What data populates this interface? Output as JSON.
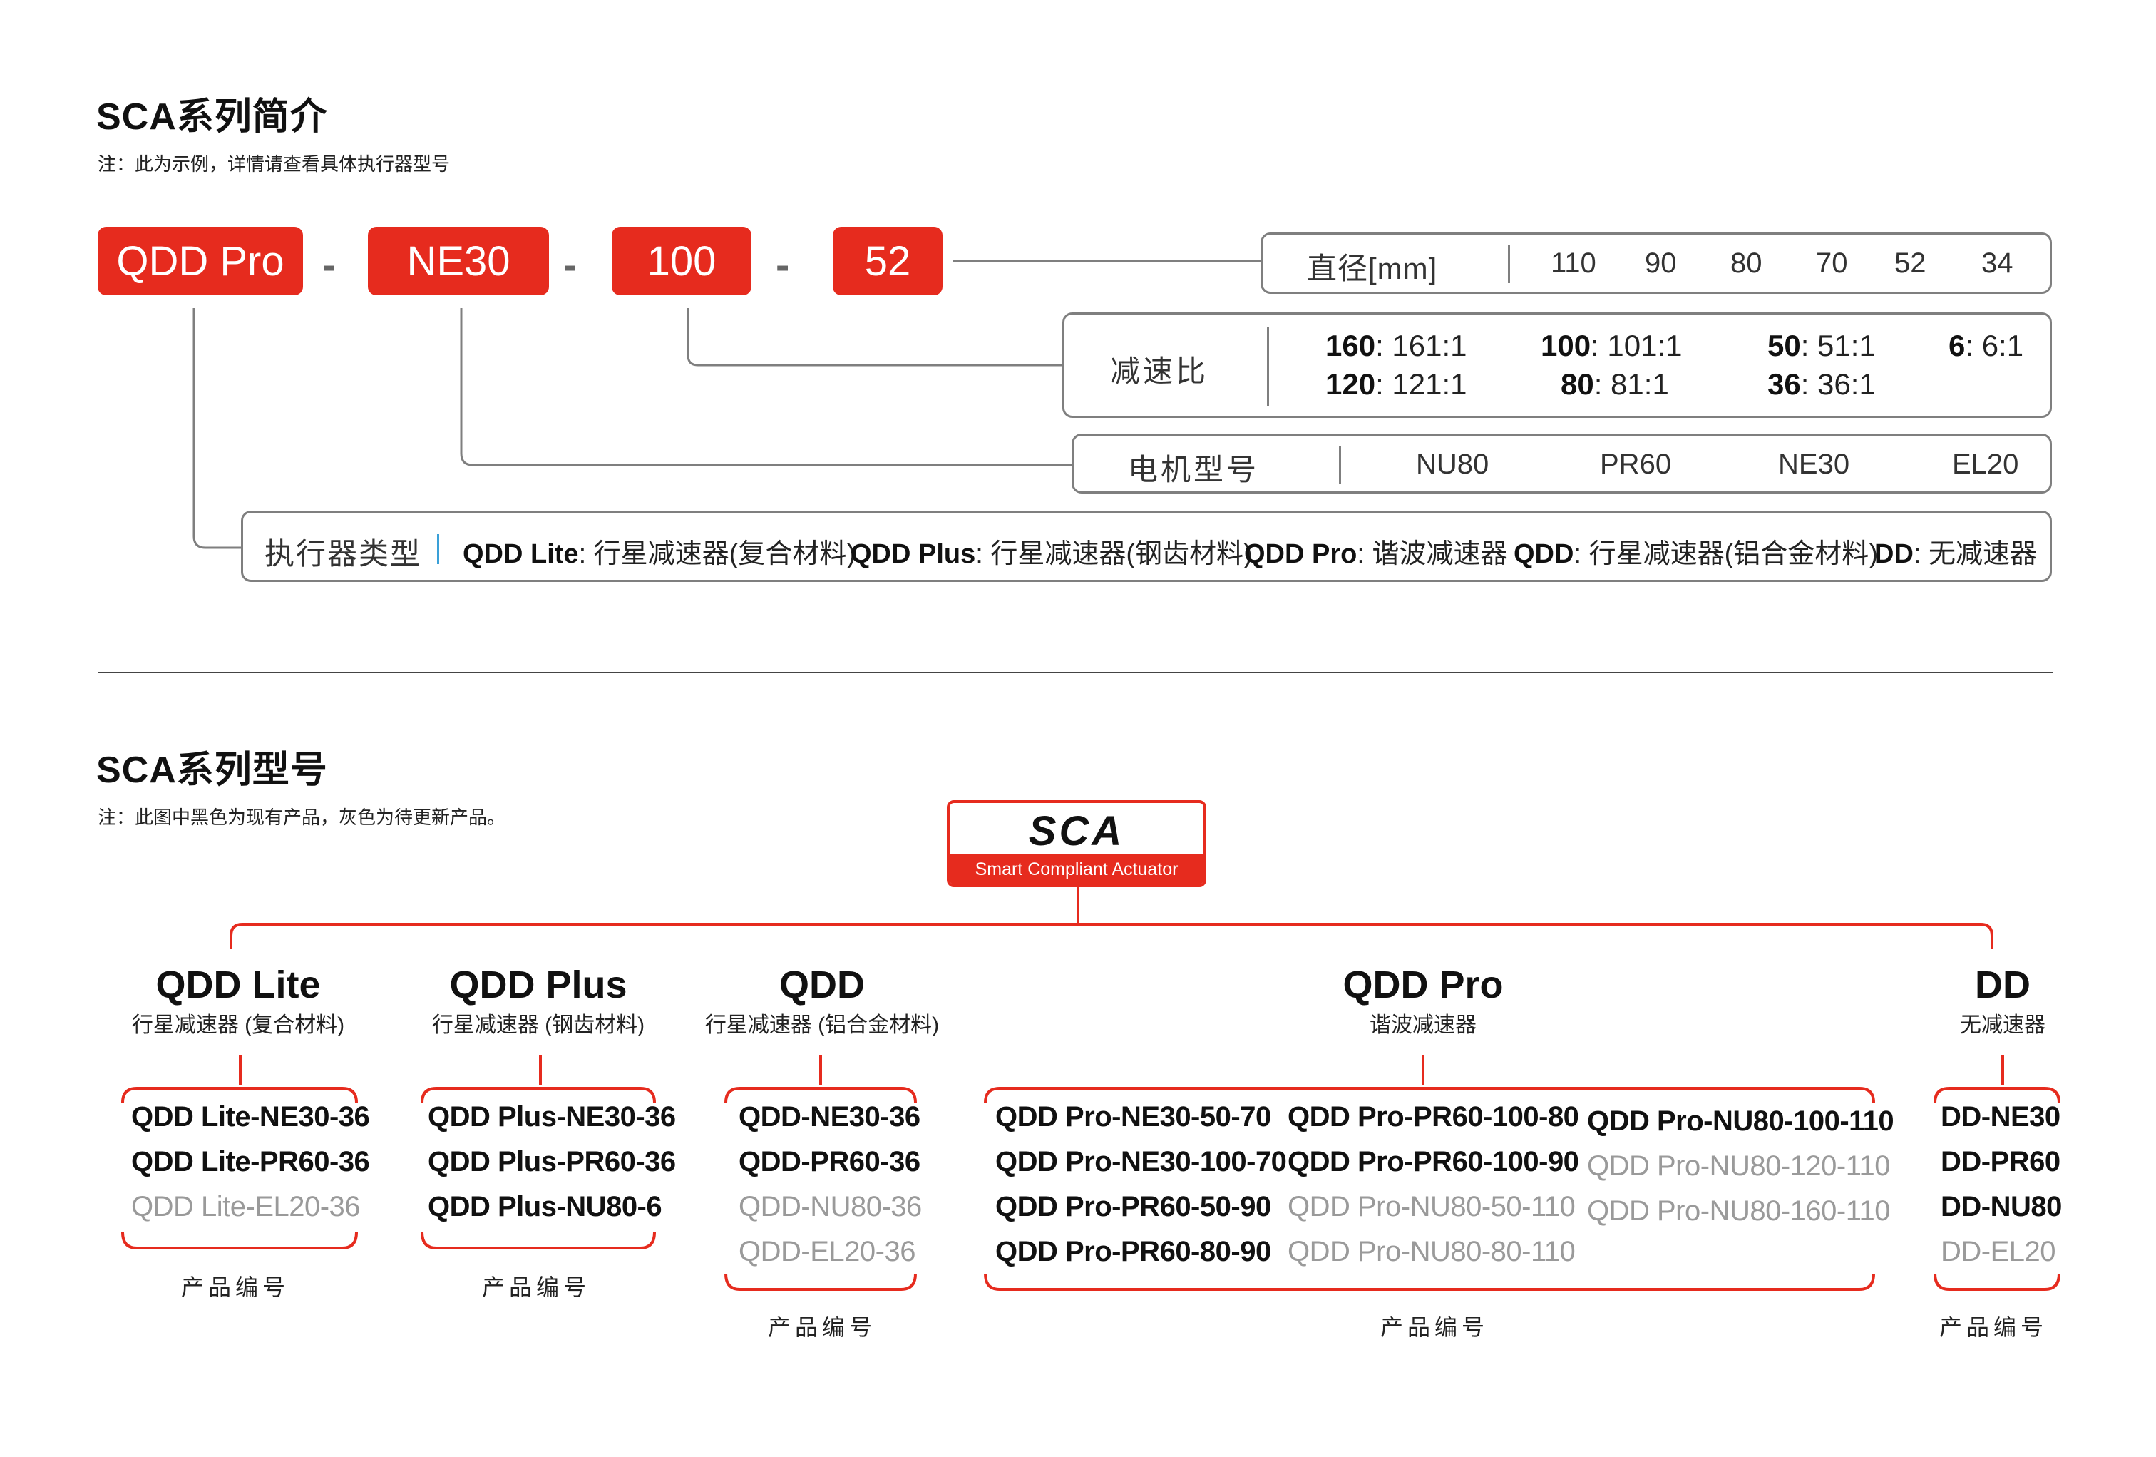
{
  "colors": {
    "accent": "#e62b1e",
    "line": "#7f7f7f",
    "gray_text": "#9a9a9a"
  },
  "section1": {
    "title": "SCA系列简介",
    "note": "注：此为示例，详情请查看具体执行器型号",
    "code_parts": [
      "QDD Pro",
      "NE30",
      "100",
      "52"
    ],
    "separator": "-",
    "diameter": {
      "label": "直径[mm]",
      "values": [
        "110",
        "90",
        "80",
        "70",
        "52",
        "34"
      ]
    },
    "ratio": {
      "label": "减速比",
      "items": [
        {
          "key": "160",
          "value": ": 161:1"
        },
        {
          "key": "120",
          "value": ": 121:1"
        },
        {
          "key": "100",
          "value": ": 101:1"
        },
        {
          "key": "80",
          "value": ": 81:1"
        },
        {
          "key": "50",
          "value": ": 51:1"
        },
        {
          "key": "36",
          "value": ": 36:1"
        },
        {
          "key": "6",
          "value": ": 6:1"
        }
      ]
    },
    "motor": {
      "label": "电机型号",
      "values": [
        "NU80",
        "PR60",
        "NE30",
        "EL20"
      ]
    },
    "actuator": {
      "label": "执行器类型",
      "items": [
        {
          "key": "QDD Lite",
          "value": ": 行星减速器(复合材料)"
        },
        {
          "key": "QDD Plus",
          "value": ": 行星减速器(钢齿材料)"
        },
        {
          "key": "QDD Pro",
          "value": ": 谐波减速器"
        },
        {
          "key": "QDD",
          "value": ": 行星减速器(铝合金材料)"
        },
        {
          "key": "DD",
          "value": ": 无减速器"
        }
      ]
    }
  },
  "section2": {
    "title": "SCA系列型号",
    "note": "注：此图中黑色为现有产品，灰色为待更新产品。",
    "logo": {
      "word": "SCA",
      "subtitle": "Smart Compliant Actuator"
    },
    "product_label": "产品编号",
    "categories": [
      {
        "name": "QDD Lite",
        "desc": "行星减速器 (复合材料)",
        "models": [
          {
            "text": "QDD Lite-NE30-36",
            "available": true
          },
          {
            "text": "QDD Lite-PR60-36",
            "available": true
          },
          {
            "text": "QDD Lite-EL20-36",
            "available": false
          }
        ]
      },
      {
        "name": "QDD Plus",
        "desc": "行星减速器 (钢齿材料)",
        "models": [
          {
            "text": "QDD Plus-NE30-36",
            "available": true
          },
          {
            "text": "QDD Plus-PR60-36",
            "available": true
          },
          {
            "text": "QDD Plus-NU80-6",
            "available": true
          }
        ]
      },
      {
        "name": "QDD",
        "desc": "行星减速器 (铝合金材料)",
        "models": [
          {
            "text": "QDD-NE30-36",
            "available": true
          },
          {
            "text": "QDD-PR60-36",
            "available": true
          },
          {
            "text": "QDD-NU80-36",
            "available": false
          },
          {
            "text": "QDD-EL20-36",
            "available": false
          }
        ]
      },
      {
        "name": "QDD Pro",
        "desc": "谐波减速器",
        "models": [
          {
            "text": "QDD Pro-NE30-50-70",
            "available": true
          },
          {
            "text": "QDD Pro-NE30-100-70",
            "available": true
          },
          {
            "text": "QDD Pro-PR60-50-90",
            "available": true
          },
          {
            "text": "QDD Pro-PR60-80-90",
            "available": true
          },
          {
            "text": "QDD Pro-PR60-100-80",
            "available": true
          },
          {
            "text": "QDD Pro-PR60-100-90",
            "available": true
          },
          {
            "text": "QDD Pro-NU80-50-110",
            "available": false
          },
          {
            "text": "QDD Pro-NU80-80-110",
            "available": false
          },
          {
            "text": "QDD Pro-NU80-100-110",
            "available": true
          },
          {
            "text": "QDD Pro-NU80-120-110",
            "available": false
          },
          {
            "text": "QDD Pro-NU80-160-110",
            "available": false
          }
        ]
      },
      {
        "name": "DD",
        "desc": "无减速器",
        "models": [
          {
            "text": "DD-NE30",
            "available": true
          },
          {
            "text": "DD-PR60",
            "available": true
          },
          {
            "text": "DD-NU80",
            "available": true
          },
          {
            "text": "DD-EL20",
            "available": false
          }
        ]
      }
    ]
  }
}
